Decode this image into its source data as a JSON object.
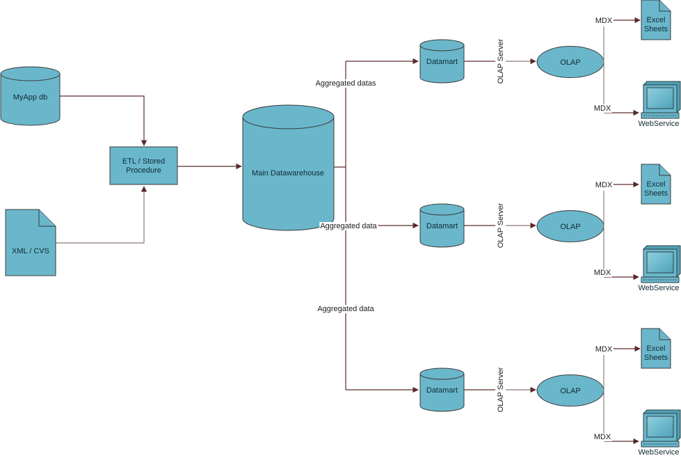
{
  "colors": {
    "node_fill": "#6ab7cb",
    "node_stroke": "#3a3a3a",
    "edge": "#5a2a2a",
    "text": "#1a1a1a",
    "background": "#ffffff"
  },
  "sources": {
    "myapp_db": {
      "label": "MyApp db",
      "icon": "database-icon"
    },
    "xml_csv": {
      "label": "XML / CVS",
      "icon": "document-icon"
    }
  },
  "etl": {
    "label_line1": "ETL / Stored",
    "label_line2": "Procedure"
  },
  "warehouse": {
    "label": "Main Datawarehouse",
    "icon": "database-icon"
  },
  "branches": [
    {
      "edge_label": "Aggregated datas",
      "datamart_label": "Datamart",
      "server_label": "OLAP Server",
      "olap_label": "OLAP",
      "mdx_top_label": "MDX",
      "mdx_bottom_label": "MDX",
      "excel_line1": "Excel",
      "excel_line2": "Sheets",
      "webservice_label": "WebService"
    },
    {
      "edge_label": "Aggregated data",
      "datamart_label": "Datamart",
      "server_label": "OLAP Server",
      "olap_label": "OLAP",
      "mdx_top_label": "MDX",
      "mdx_bottom_label": "MDX",
      "excel_line1": "Excel",
      "excel_line2": "Sheets",
      "webservice_label": "WebService"
    },
    {
      "edge_label": "Aggregated data",
      "datamart_label": "Datamart",
      "server_label": "OLAP Server",
      "olap_label": "OLAP",
      "mdx_top_label": "MDX",
      "mdx_bottom_label": "MDX",
      "excel_line1": "Excel",
      "excel_line2": "Sheets",
      "webservice_label": "WebService"
    }
  ]
}
